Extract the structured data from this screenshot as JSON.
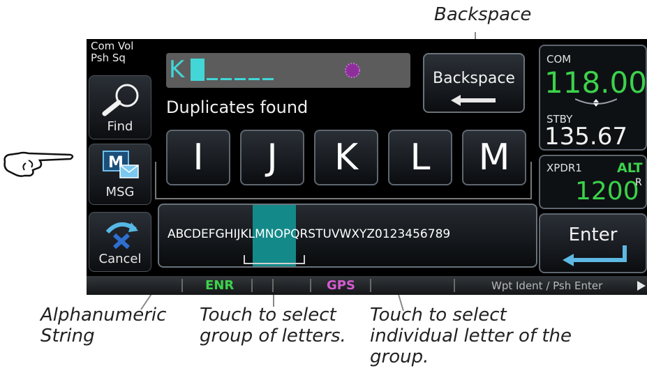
{
  "callouts": {
    "backspace": "Backspace",
    "alphanumeric": "Alphanumeric\nString",
    "group": "Touch to select\ngroup of letters.",
    "individual": "Touch to select\nindividual letter of the\ngroup."
  },
  "side_buttons": {
    "com_vol": "Com Vol\nPsh Sq",
    "find": "Find",
    "msg": "MSG",
    "cancel": "Cancel"
  },
  "input": {
    "value": "K"
  },
  "backspace_label": "Backspace",
  "duplicates_text": "Duplicates found",
  "letter_buttons": [
    "I",
    "J",
    "K",
    "L",
    "M"
  ],
  "alphanumeric": {
    "before": "ABCDEFGH",
    "group": "IJKLM",
    "after": "NOPQRSTUVWXYZ0123456789"
  },
  "com": {
    "label": "COM",
    "active": "118.00",
    "standby_label": "STBY",
    "standby": "135.67"
  },
  "xpdr": {
    "label": "XPDR1",
    "mode": "ALT",
    "code": "1200",
    "reply": "R"
  },
  "enter_label": "Enter",
  "status_bar": {
    "enr": "ENR",
    "gps": "GPS",
    "hint": "Wpt Ident / Psh Enter"
  },
  "colors": {
    "accent_cyan": "#43d6d6",
    "highlight_teal": "#148989",
    "com_green": "#3cd24b",
    "gps_magenta": "#d65ad0"
  }
}
